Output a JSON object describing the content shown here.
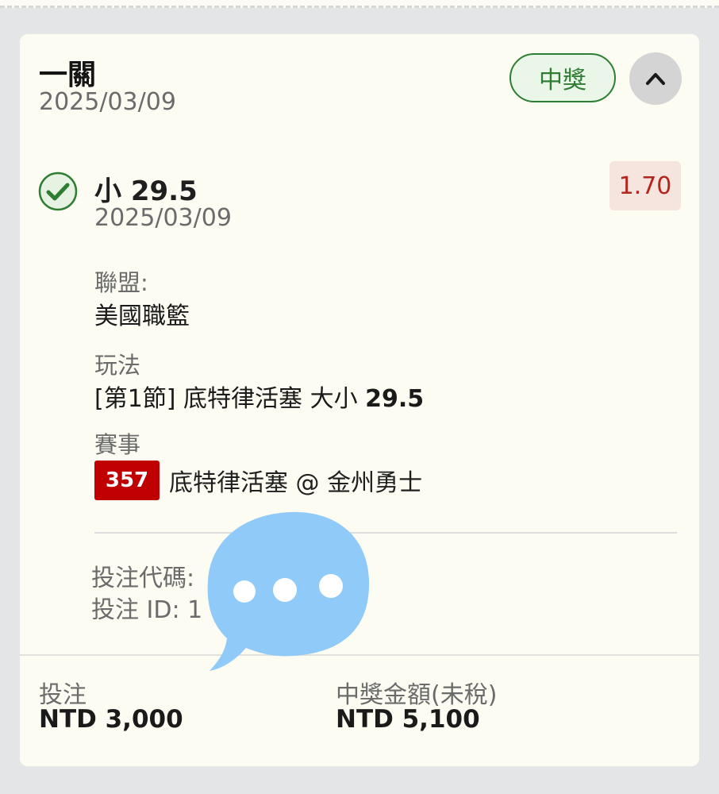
{
  "card": {
    "title": "一關",
    "date": "2025/03/09",
    "status_badge": "中獎"
  },
  "selection": {
    "name": "小 29.5",
    "date": "2025/03/09",
    "odds": "1.70",
    "league_label": "聯盟:",
    "league_value": "美國職籃",
    "market_label": "玩法",
    "market_prefix": "[第1節] 底特律活塞 大小 ",
    "market_line": "29.5",
    "event_label": "賽事",
    "event_number": "357",
    "event_name": "底特律活塞 @ 金州勇士"
  },
  "bet_info": {
    "code_label": "投注代碼:",
    "id_label": "投注 ID: 1"
  },
  "footer": {
    "stake_label": "投注",
    "stake_value": "NTD 3,000",
    "payout_label": "中獎金額(未稅)",
    "payout_value": "NTD 5,100"
  },
  "colors": {
    "win_green": "#2e7d32",
    "odds_red": "#b3261e",
    "event_badge_red": "#c00000",
    "chat_bubble_blue": "#90caf9"
  },
  "icons": {
    "status": "check-circle-icon",
    "collapse": "chevron-up-icon",
    "overlay": "chat-bubble-icon"
  }
}
